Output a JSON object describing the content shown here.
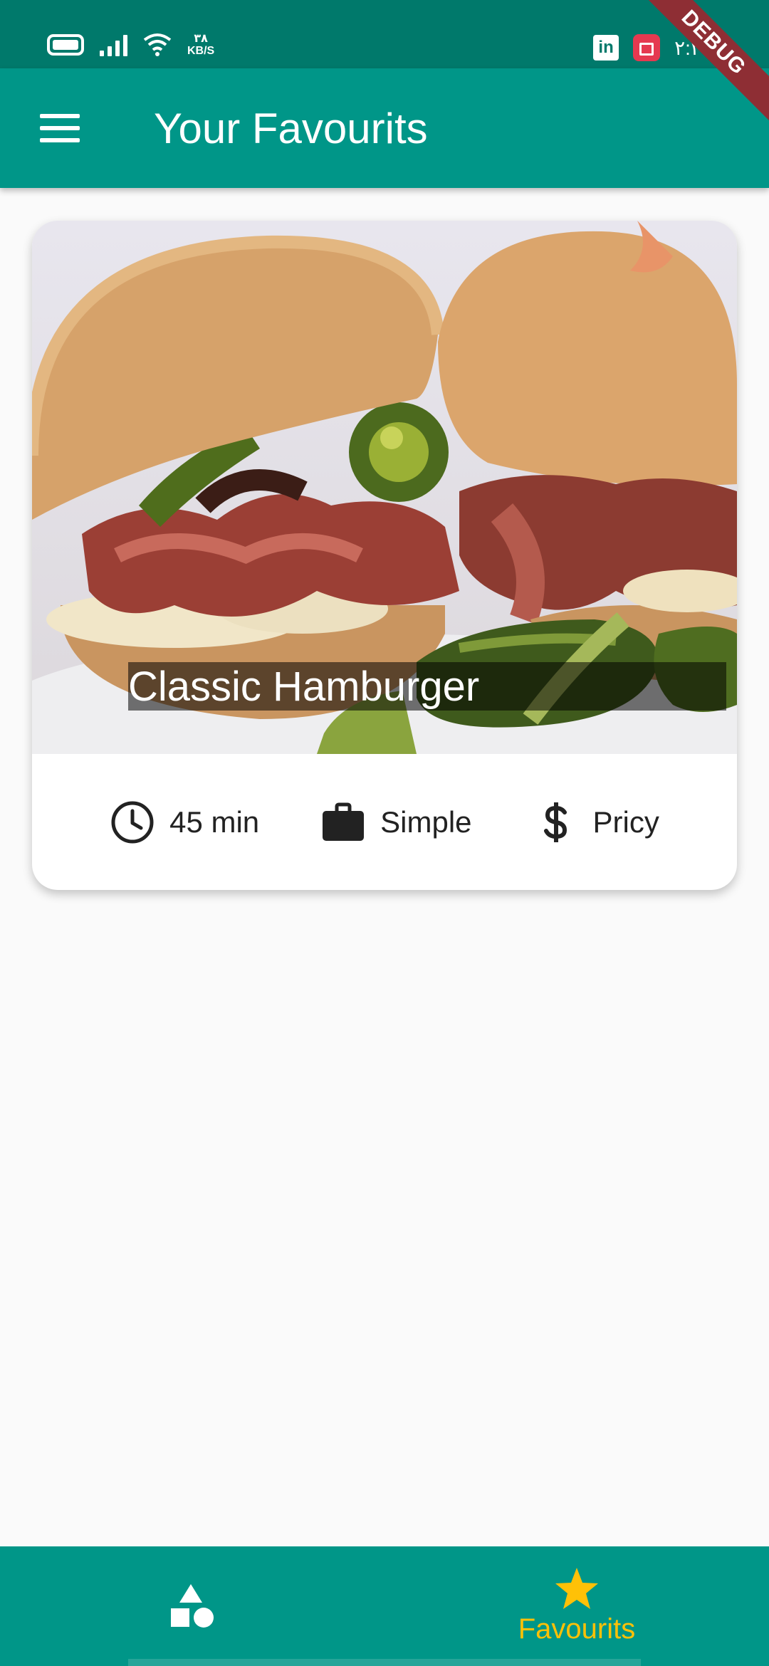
{
  "status_bar": {
    "net_speed_value": "۳۸",
    "net_speed_unit": "KB/S",
    "clock": "۲:۲۲"
  },
  "debug_banner": "DEBUG",
  "app_bar": {
    "title": "Your Favourits"
  },
  "meals": [
    {
      "title": "Classic Hamburger",
      "duration": "45 min",
      "complexity": "Simple",
      "affordability": "Pricy"
    }
  ],
  "bottom_nav": {
    "items": [
      {
        "icon": "category-icon",
        "label": ""
      },
      {
        "icon": "star-icon",
        "label": "Favourits"
      }
    ],
    "selected_color": "#ffc107"
  },
  "colors": {
    "primary": "#009688",
    "status_bar": "#00796b",
    "accent": "#ffc107",
    "debug_ribbon": "#8e2e34"
  }
}
